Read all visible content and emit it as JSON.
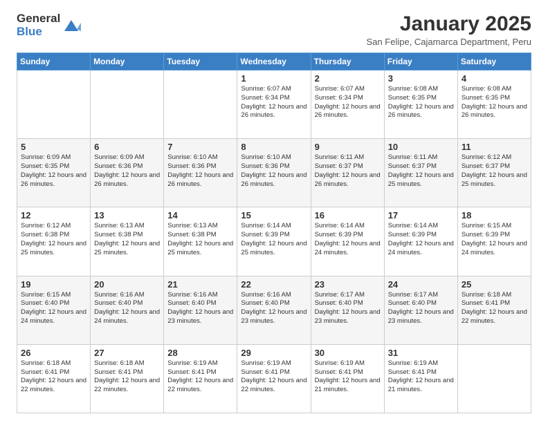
{
  "logo": {
    "general": "General",
    "blue": "Blue"
  },
  "title": "January 2025",
  "subtitle": "San Felipe, Cajamarca Department, Peru",
  "weekdays": [
    "Sunday",
    "Monday",
    "Tuesday",
    "Wednesday",
    "Thursday",
    "Friday",
    "Saturday"
  ],
  "weeks": [
    [
      {
        "day": "",
        "info": ""
      },
      {
        "day": "",
        "info": ""
      },
      {
        "day": "",
        "info": ""
      },
      {
        "day": "1",
        "info": "Sunrise: 6:07 AM\nSunset: 6:34 PM\nDaylight: 12 hours and 26 minutes."
      },
      {
        "day": "2",
        "info": "Sunrise: 6:07 AM\nSunset: 6:34 PM\nDaylight: 12 hours and 26 minutes."
      },
      {
        "day": "3",
        "info": "Sunrise: 6:08 AM\nSunset: 6:35 PM\nDaylight: 12 hours and 26 minutes."
      },
      {
        "day": "4",
        "info": "Sunrise: 6:08 AM\nSunset: 6:35 PM\nDaylight: 12 hours and 26 minutes."
      }
    ],
    [
      {
        "day": "5",
        "info": "Sunrise: 6:09 AM\nSunset: 6:35 PM\nDaylight: 12 hours and 26 minutes."
      },
      {
        "day": "6",
        "info": "Sunrise: 6:09 AM\nSunset: 6:36 PM\nDaylight: 12 hours and 26 minutes."
      },
      {
        "day": "7",
        "info": "Sunrise: 6:10 AM\nSunset: 6:36 PM\nDaylight: 12 hours and 26 minutes."
      },
      {
        "day": "8",
        "info": "Sunrise: 6:10 AM\nSunset: 6:36 PM\nDaylight: 12 hours and 26 minutes."
      },
      {
        "day": "9",
        "info": "Sunrise: 6:11 AM\nSunset: 6:37 PM\nDaylight: 12 hours and 26 minutes."
      },
      {
        "day": "10",
        "info": "Sunrise: 6:11 AM\nSunset: 6:37 PM\nDaylight: 12 hours and 25 minutes."
      },
      {
        "day": "11",
        "info": "Sunrise: 6:12 AM\nSunset: 6:37 PM\nDaylight: 12 hours and 25 minutes."
      }
    ],
    [
      {
        "day": "12",
        "info": "Sunrise: 6:12 AM\nSunset: 6:38 PM\nDaylight: 12 hours and 25 minutes."
      },
      {
        "day": "13",
        "info": "Sunrise: 6:13 AM\nSunset: 6:38 PM\nDaylight: 12 hours and 25 minutes."
      },
      {
        "day": "14",
        "info": "Sunrise: 6:13 AM\nSunset: 6:38 PM\nDaylight: 12 hours and 25 minutes."
      },
      {
        "day": "15",
        "info": "Sunrise: 6:14 AM\nSunset: 6:39 PM\nDaylight: 12 hours and 25 minutes."
      },
      {
        "day": "16",
        "info": "Sunrise: 6:14 AM\nSunset: 6:39 PM\nDaylight: 12 hours and 24 minutes."
      },
      {
        "day": "17",
        "info": "Sunrise: 6:14 AM\nSunset: 6:39 PM\nDaylight: 12 hours and 24 minutes."
      },
      {
        "day": "18",
        "info": "Sunrise: 6:15 AM\nSunset: 6:39 PM\nDaylight: 12 hours and 24 minutes."
      }
    ],
    [
      {
        "day": "19",
        "info": "Sunrise: 6:15 AM\nSunset: 6:40 PM\nDaylight: 12 hours and 24 minutes."
      },
      {
        "day": "20",
        "info": "Sunrise: 6:16 AM\nSunset: 6:40 PM\nDaylight: 12 hours and 24 minutes."
      },
      {
        "day": "21",
        "info": "Sunrise: 6:16 AM\nSunset: 6:40 PM\nDaylight: 12 hours and 23 minutes."
      },
      {
        "day": "22",
        "info": "Sunrise: 6:16 AM\nSunset: 6:40 PM\nDaylight: 12 hours and 23 minutes."
      },
      {
        "day": "23",
        "info": "Sunrise: 6:17 AM\nSunset: 6:40 PM\nDaylight: 12 hours and 23 minutes."
      },
      {
        "day": "24",
        "info": "Sunrise: 6:17 AM\nSunset: 6:40 PM\nDaylight: 12 hours and 23 minutes."
      },
      {
        "day": "25",
        "info": "Sunrise: 6:18 AM\nSunset: 6:41 PM\nDaylight: 12 hours and 22 minutes."
      }
    ],
    [
      {
        "day": "26",
        "info": "Sunrise: 6:18 AM\nSunset: 6:41 PM\nDaylight: 12 hours and 22 minutes."
      },
      {
        "day": "27",
        "info": "Sunrise: 6:18 AM\nSunset: 6:41 PM\nDaylight: 12 hours and 22 minutes."
      },
      {
        "day": "28",
        "info": "Sunrise: 6:19 AM\nSunset: 6:41 PM\nDaylight: 12 hours and 22 minutes."
      },
      {
        "day": "29",
        "info": "Sunrise: 6:19 AM\nSunset: 6:41 PM\nDaylight: 12 hours and 22 minutes."
      },
      {
        "day": "30",
        "info": "Sunrise: 6:19 AM\nSunset: 6:41 PM\nDaylight: 12 hours and 21 minutes."
      },
      {
        "day": "31",
        "info": "Sunrise: 6:19 AM\nSunset: 6:41 PM\nDaylight: 12 hours and 21 minutes."
      },
      {
        "day": "",
        "info": ""
      }
    ]
  ],
  "accent_color": "#3a7ec4"
}
